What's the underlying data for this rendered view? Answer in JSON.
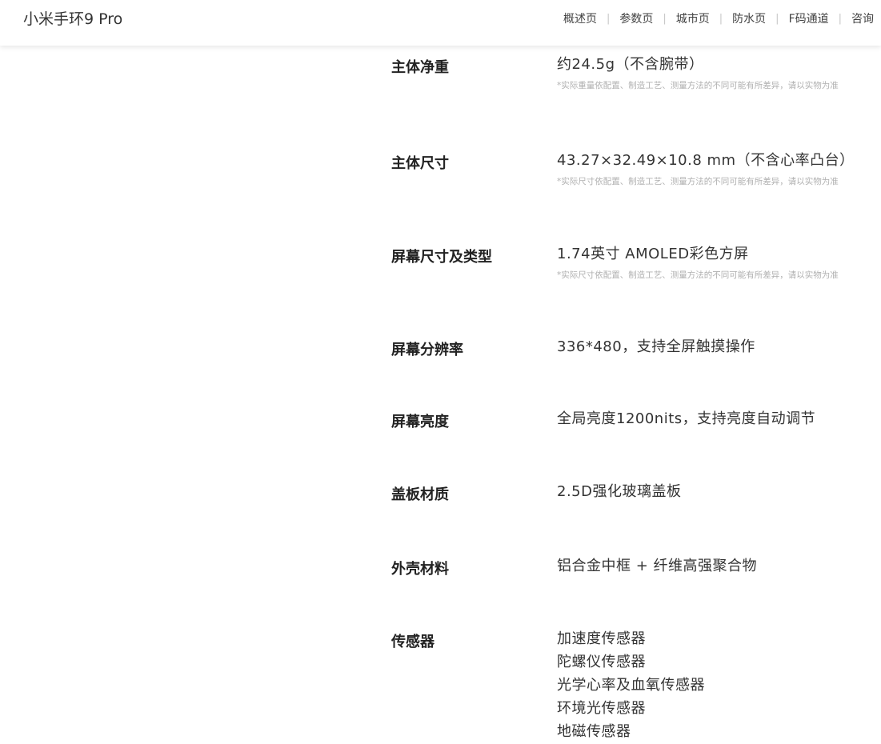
{
  "header": {
    "brand": "小米手环9 Pro",
    "nav": [
      {
        "label": "概述页"
      },
      {
        "label": "参数页"
      },
      {
        "label": "城市页"
      },
      {
        "label": "防水页"
      },
      {
        "label": "F码通道"
      },
      {
        "label": "咨询"
      }
    ],
    "separator": "|"
  },
  "specs": [
    {
      "label": "主体净重",
      "values": [
        "约24.5g（不含腕带）"
      ],
      "note": "*实际重量依配置、制造工艺、测量方法的不同可能有所差异，请以实物为准"
    },
    {
      "label": "主体尺寸",
      "values": [
        "43.27×32.49×10.8 mm（不含心率凸台）"
      ],
      "note": "*实际尺寸依配置、制造工艺、测量方法的不同可能有所差异，请以实物为准"
    },
    {
      "label": "屏幕尺寸及类型",
      "values": [
        "1.74英寸 AMOLED彩色方屏"
      ],
      "note": "*实际尺寸依配置、制造工艺、测量方法的不同可能有所差异，请以实物为准"
    },
    {
      "label": "屏幕分辨率",
      "values": [
        "336*480，支持全屏触摸操作"
      ]
    },
    {
      "label": "屏幕亮度",
      "values": [
        "全局亮度1200nits，支持亮度自动调节"
      ]
    },
    {
      "label": "盖板材质",
      "values": [
        "2.5D强化玻璃盖板"
      ]
    },
    {
      "label": "外壳材料",
      "values": [
        "铝合金中框 + 纤维高强聚合物"
      ]
    },
    {
      "label": "传感器",
      "values": [
        "加速度传感器",
        "陀螺仪传感器",
        "光学心率及血氧传感器",
        "环境光传感器",
        "地磁传感器"
      ]
    }
  ]
}
